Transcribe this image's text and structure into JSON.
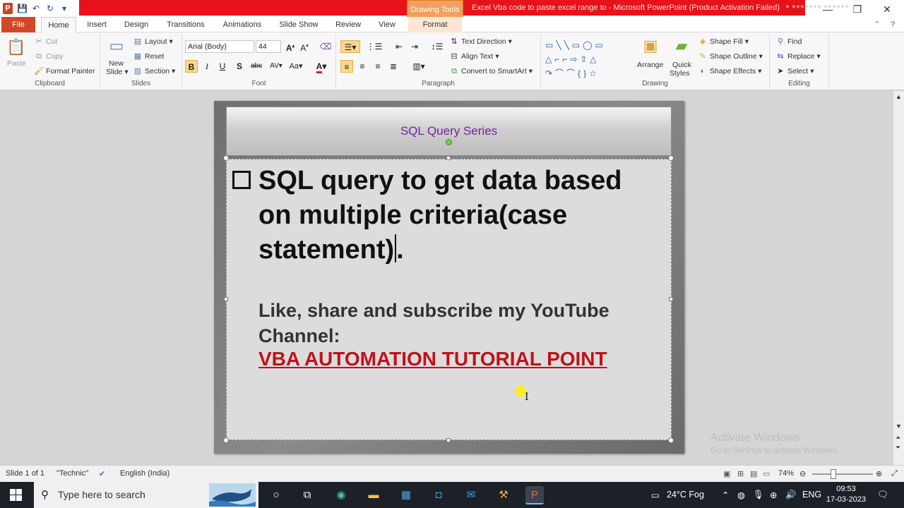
{
  "window": {
    "title": "Excel Vba code to paste excel range to  -  Microsoft PowerPoint (Product Activation Failed)",
    "context_tab_group": "Drawing Tools"
  },
  "quick_access": {
    "app_letter": "P"
  },
  "tabs": [
    "File",
    "Home",
    "Insert",
    "Design",
    "Transitions",
    "Animations",
    "Slide Show",
    "Review",
    "View",
    "Format"
  ],
  "ribbon": {
    "clipboard": {
      "label": "Clipboard",
      "paste": "Paste",
      "cut": "Cut",
      "copy": "Copy",
      "format_painter": "Format Painter"
    },
    "slides": {
      "label": "Slides",
      "new_slide_line1": "New",
      "new_slide_line2": "Slide",
      "layout": "Layout",
      "reset": "Reset",
      "section": "Section"
    },
    "font": {
      "label": "Font",
      "font_name": "Arial (Body)",
      "font_size": "44",
      "bold": "B",
      "italic": "I",
      "underline": "U",
      "shadow": "S",
      "strike": "abc",
      "spacing": "AV",
      "change_case": "Aa",
      "color": "A"
    },
    "paragraph": {
      "label": "Paragraph",
      "text_direction": "Text Direction",
      "align_text": "Align Text",
      "convert_smartart": "Convert to SmartArt"
    },
    "drawing": {
      "label": "Drawing",
      "arrange": "Arrange",
      "quick_styles_line1": "Quick",
      "quick_styles_line2": "Styles",
      "shape_fill": "Shape Fill",
      "shape_outline": "Shape Outline",
      "shape_effects": "Shape Effects"
    },
    "editing": {
      "label": "Editing",
      "find": "Find",
      "replace": "Replace",
      "select": "Select"
    }
  },
  "slide": {
    "header_title": "SQL Query Series",
    "bullet_main": "SQL query to get data based on multiple criteria(case statement)",
    "bullet_end": ".",
    "sub_line1": "Like, share and subscribe my YouTube",
    "sub_line2": "Channel:",
    "link_text": "VBA AUTOMATION TUTORIAL POINT"
  },
  "watermark": {
    "line1": "Activate Windows",
    "line2": "Go to Settings to activate Windows."
  },
  "status": {
    "slide_info": "Slide 1 of 1",
    "theme": "\"Technic\"",
    "language": "English (India)",
    "zoom": "74%"
  },
  "taskbar": {
    "search_placeholder": "Type here to search",
    "weather": "24°C  Fog",
    "lang": "ENG",
    "time": "09:53",
    "date": "17-03-2023"
  }
}
